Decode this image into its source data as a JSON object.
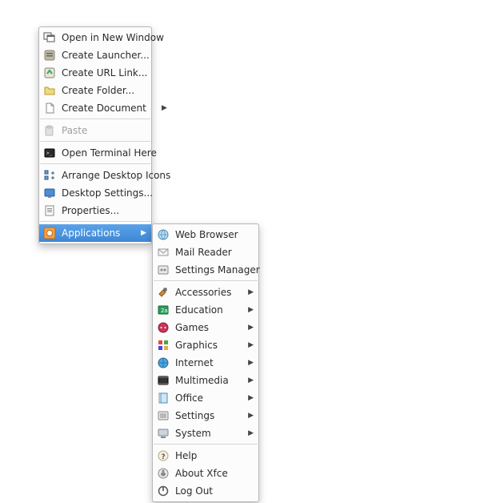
{
  "main": {
    "open_new_window": "Open in New Window",
    "create_launcher": "Create Launcher...",
    "create_url_link": "Create URL Link...",
    "create_folder": "Create Folder...",
    "create_document": "Create Document",
    "paste": "Paste",
    "open_terminal": "Open Terminal Here",
    "arrange_icons": "Arrange Desktop Icons",
    "desktop_settings": "Desktop Settings...",
    "properties": "Properties...",
    "applications": "Applications"
  },
  "sub": {
    "web_browser": "Web Browser",
    "mail_reader": "Mail Reader",
    "settings_manager": "Settings Manager",
    "accessories": "Accessories",
    "education": "Education",
    "games": "Games",
    "graphics": "Graphics",
    "internet": "Internet",
    "multimedia": "Multimedia",
    "office": "Office",
    "settings": "Settings",
    "system": "System",
    "help": "Help",
    "about_xfce": "About Xfce",
    "log_out": "Log Out"
  }
}
